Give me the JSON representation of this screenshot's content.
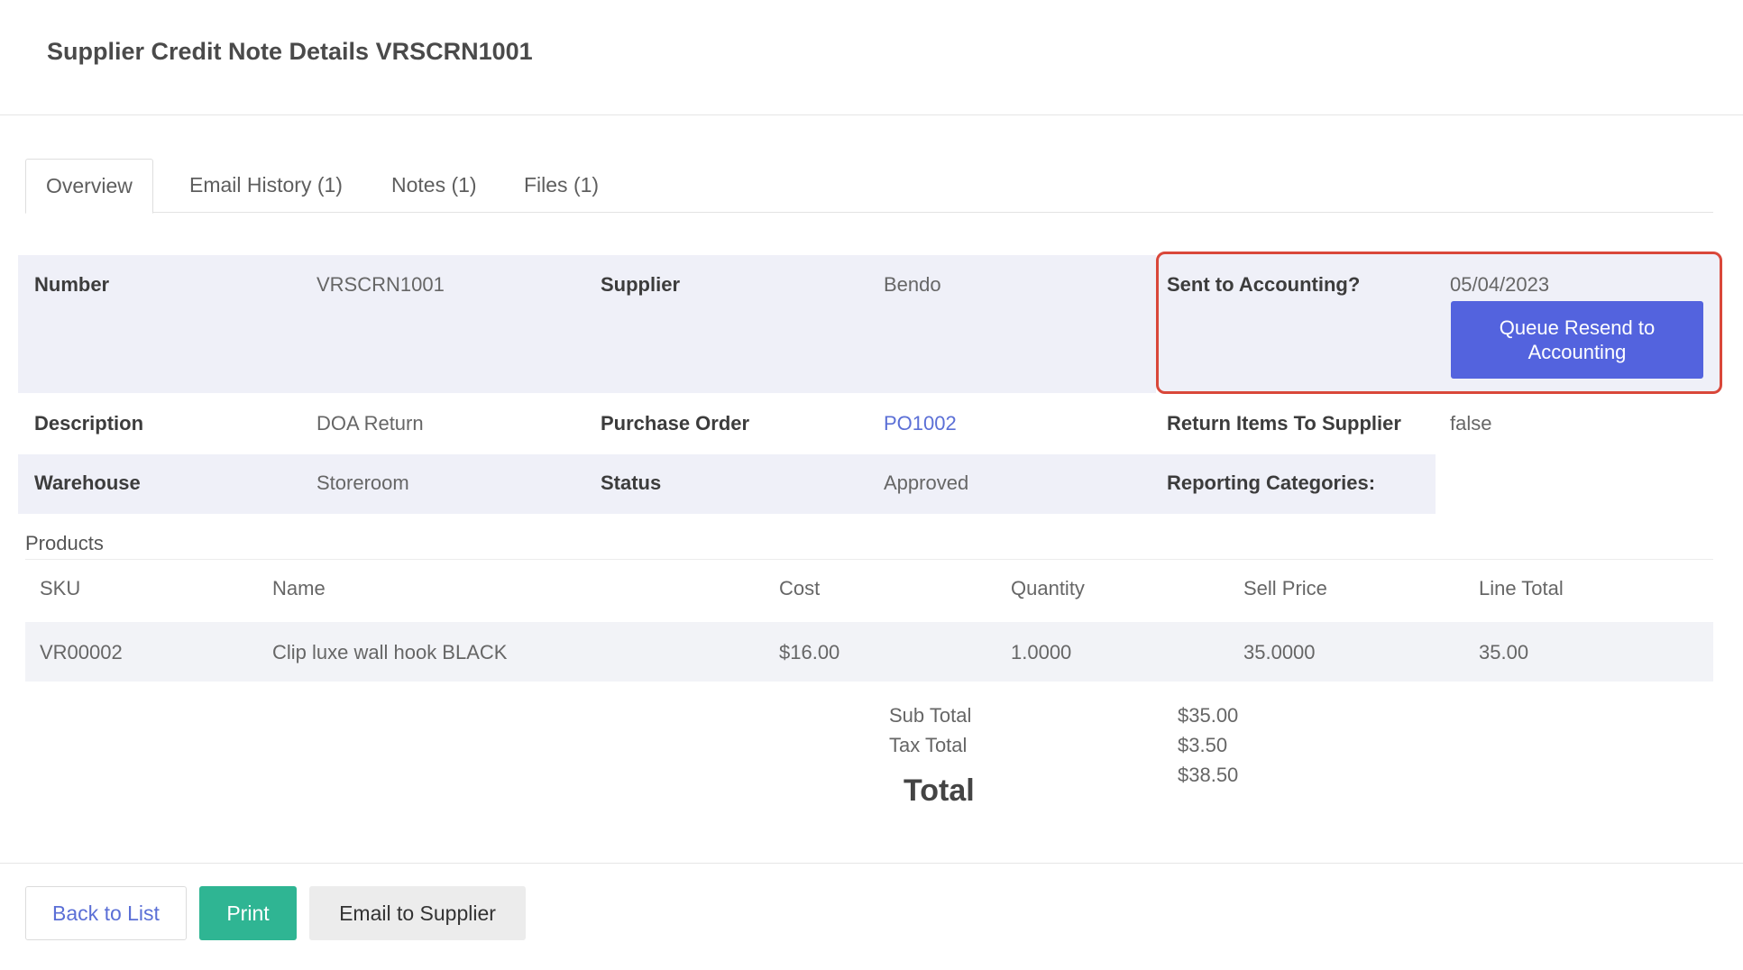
{
  "page": {
    "title": "Supplier Credit Note Details VRSCRN1001"
  },
  "tabs": [
    {
      "label": "Overview"
    },
    {
      "label": "Email History (1)"
    },
    {
      "label": "Notes (1)"
    },
    {
      "label": "Files (1)"
    }
  ],
  "details": {
    "number_label": "Number",
    "number_value": "VRSCRN1001",
    "supplier_label": "Supplier",
    "supplier_value": "Bendo",
    "sent_label": "Sent to Accounting?",
    "sent_value": "05/04/2023",
    "queue_button": "Queue Resend to Accounting",
    "description_label": "Description",
    "description_value": "DOA Return",
    "po_label": "Purchase Order",
    "po_value": "PO1002",
    "return_label": "Return Items To Supplier",
    "return_value": "false",
    "warehouse_label": "Warehouse",
    "warehouse_value": "Storeroom",
    "status_label": "Status",
    "status_value": "Approved",
    "reporting_label": "Reporting Categories:"
  },
  "products": {
    "title": "Products",
    "columns": [
      "SKU",
      "Name",
      "Cost",
      "Quantity",
      "Sell Price",
      "Line Total"
    ],
    "rows": [
      [
        "VR00002",
        "Clip luxe wall hook BLACK",
        "$16.00",
        "1.0000",
        "35.0000",
        "35.00"
      ]
    ]
  },
  "totals": {
    "sub_total_label": "Sub Total",
    "sub_total_value": "$35.00",
    "tax_total_label": "Tax Total",
    "tax_total_value": "$3.50",
    "total_label": "Total",
    "total_value": "$38.50"
  },
  "footer": {
    "back_label": "Back to List",
    "print_label": "Print",
    "email_label": "Email to Supplier"
  },
  "colors": {
    "primary": "#5363de",
    "success": "#2fb593",
    "highlight": "#d9473a",
    "link": "#5b6fd6"
  }
}
